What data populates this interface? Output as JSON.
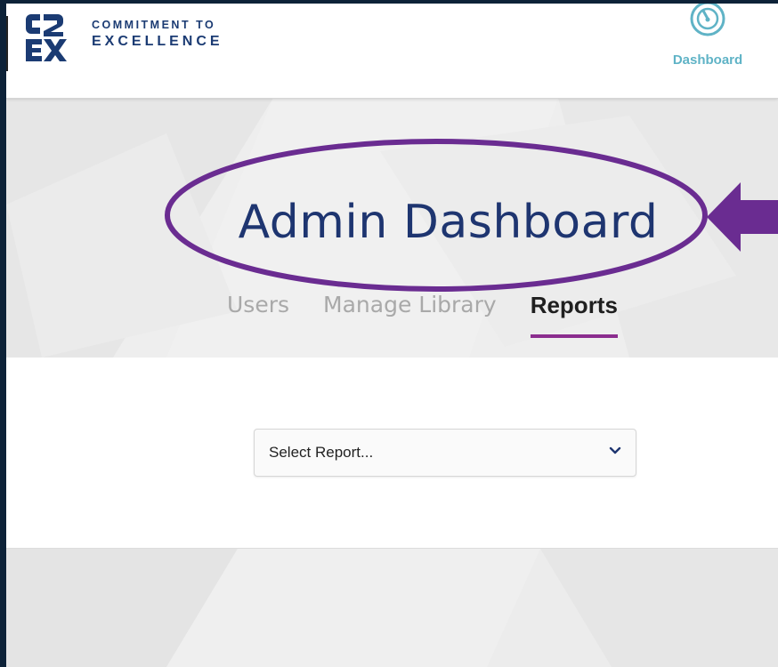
{
  "header": {
    "logo_line1": "COMMITMENT TO",
    "logo_line2": "EXCELLENCE",
    "logo_mark": "C2EX",
    "nav": {
      "dashboard_label": "Dashboard",
      "dashboard_icon": "gauge-icon"
    }
  },
  "page": {
    "title": "Admin Dashboard",
    "tabs": [
      {
        "label": "Users",
        "active": false
      },
      {
        "label": "Manage Library",
        "active": false
      },
      {
        "label": "Reports",
        "active": true
      }
    ]
  },
  "report_select": {
    "placeholder": "Select Report...",
    "icon": "chevron-down-icon"
  },
  "annotation": {
    "shape": "ellipse-highlight",
    "pointer": "arrow-left-icon",
    "color": "#6a2c91"
  },
  "colors": {
    "brand_navy": "#1b3b73",
    "accent_teal": "#5fb3c6",
    "tab_underline": "#8b2d8e",
    "outer_background": "#0d2238"
  }
}
